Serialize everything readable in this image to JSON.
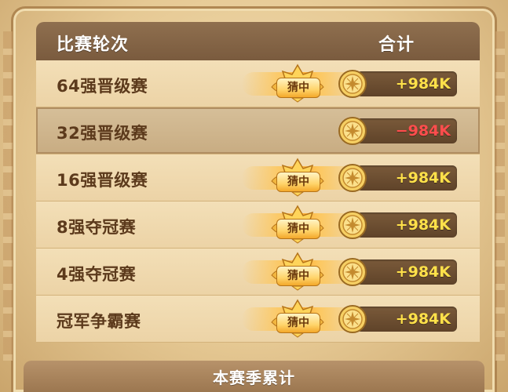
{
  "header": {
    "round_label": "比赛轮次",
    "total_label": "合计"
  },
  "rows": [
    {
      "round": "64强晋级赛",
      "badge": "猜中",
      "value": "+984K"
    },
    {
      "round": "32强晋级赛",
      "badge": "",
      "value": "−984K"
    },
    {
      "round": "16强晋级赛",
      "badge": "猜中",
      "value": "+984K"
    },
    {
      "round": "8强夺冠赛",
      "badge": "猜中",
      "value": "+984K"
    },
    {
      "round": "4强夺冠赛",
      "badge": "猜中",
      "value": "+984K"
    },
    {
      "round": "冠军争霸赛",
      "badge": "猜中",
      "value": "+984K"
    }
  ],
  "footer": {
    "title": "本赛季累计"
  },
  "icons": {
    "badge": "crown-badge-icon",
    "coin": "gold-coin-icon"
  },
  "colors": {
    "positive": "#ffe14a",
    "negative": "#ff4d4d",
    "header_bg": "#8f6f4f"
  }
}
